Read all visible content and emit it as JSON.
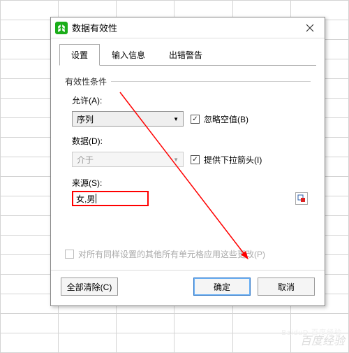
{
  "window": {
    "title": "数据有效性"
  },
  "tabs": {
    "t1": "设置",
    "t2": "输入信息",
    "t3": "出错警告"
  },
  "fieldset": {
    "criteria": "有效性条件"
  },
  "labels": {
    "allow": "允许(A):",
    "data": "数据(D):",
    "source": "来源(S):"
  },
  "dropdowns": {
    "allow_value": "序列",
    "data_value": "介于"
  },
  "checkboxes": {
    "ignore_blank": "忽略空值(B)",
    "dropdown_arrow": "提供下拉箭头(I)",
    "apply_all": "对所有同样设置的其他所有单元格应用这些更改(P)"
  },
  "input": {
    "source_value": "女,男"
  },
  "buttons": {
    "clear_all": "全部清除(C)",
    "ok": "确定",
    "cancel": "取消"
  },
  "watermark": {
    "sub": "BaiduD 百度经验",
    "main": "百度经验"
  }
}
